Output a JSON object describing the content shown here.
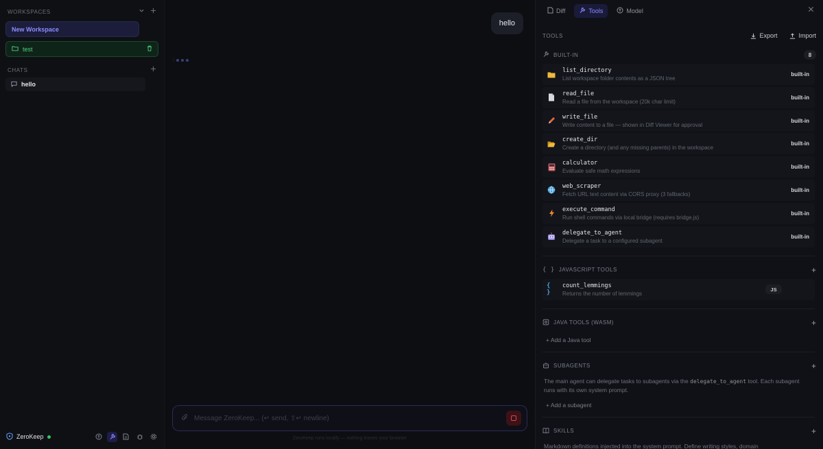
{
  "sidebar": {
    "workspaces_label": "WORKSPACES",
    "new_workspace_label": "New Workspace",
    "workspace_items": [
      {
        "label": "test"
      }
    ],
    "chats_label": "CHATS",
    "chat_items": [
      {
        "label": "hello"
      }
    ],
    "brand": "ZeroKeep"
  },
  "main": {
    "user_message": "hello",
    "composer_placeholder": "Message ZeroKeep... (↵ send, ⇧↵ newline)",
    "disclaimer": "ZeroKeep runs locally — nothing leaves your browser"
  },
  "panel": {
    "tabs": [
      {
        "label": "Diff",
        "icon": "file-diff-icon"
      },
      {
        "label": "Tools",
        "icon": "wrench-icon"
      },
      {
        "label": "Model",
        "icon": "cpu-icon"
      }
    ],
    "tools_label": "TOOLS",
    "export_label": "Export",
    "import_label": "Import",
    "builtin_label": "BUILT-IN",
    "builtin_count": "8",
    "builtin_tools": [
      {
        "name": "list_directory",
        "desc": "List workspace folder contents as a JSON tree",
        "badge": "built-in",
        "icon": "folder-icon",
        "color": "#f0b93a"
      },
      {
        "name": "read_file",
        "desc": "Read a file from the workspace (20k char limit)",
        "badge": "built-in",
        "icon": "file-icon",
        "color": "#d8d9de"
      },
      {
        "name": "write_file",
        "desc": "Write content to a file — shown in Diff Viewer for approval",
        "badge": "built-in",
        "icon": "pencil-icon",
        "color": "#e86a3a"
      },
      {
        "name": "create_dir",
        "desc": "Create a directory (and any missing parents) in the workspace",
        "badge": "built-in",
        "icon": "folder-open-icon",
        "color": "#f0b93a"
      },
      {
        "name": "calculator",
        "desc": "Evaluate safe math expressions",
        "badge": "built-in",
        "icon": "calculator-icon",
        "color": "#c2546a"
      },
      {
        "name": "web_scraper",
        "desc": "Fetch URL text content via CORS proxy (3 fallbacks)",
        "badge": "built-in",
        "icon": "globe-icon",
        "color": "#4aa3d8"
      },
      {
        "name": "execute_command",
        "desc": "Run shell commands via local bridge (requires bridge.js)",
        "badge": "built-in",
        "icon": "lightning-icon",
        "color": "#f08a2a"
      },
      {
        "name": "delegate_to_agent",
        "desc": "Delegate a task to a configured subagent",
        "badge": "built-in",
        "icon": "robot-icon",
        "color": "#9a8ce0"
      }
    ],
    "js_tools_label": "JAVASCRIPT TOOLS",
    "js_tools": [
      {
        "name": "count_lemmings",
        "desc": "Returns the number of lemmings",
        "badge": "JS",
        "icon": "braces-icon",
        "color": "#4aa3d8"
      }
    ],
    "java_tools_label": "JAVA TOOLS (WASM)",
    "add_java_label": "+ Add a Java tool",
    "subagents_label": "SUBAGENTS",
    "subagents_desc_pre": "The main agent can delegate tasks to subagents via the",
    "subagents_desc_code": "delegate_to_agent",
    "subagents_desc_post": "tool. Each subagent runs with its own system prompt.",
    "add_subagent_label": "+ Add a subagent",
    "skills_label": "SKILLS",
    "skills_desc": "Markdown definitions injected into the system prompt. Define writing styles, domain"
  }
}
